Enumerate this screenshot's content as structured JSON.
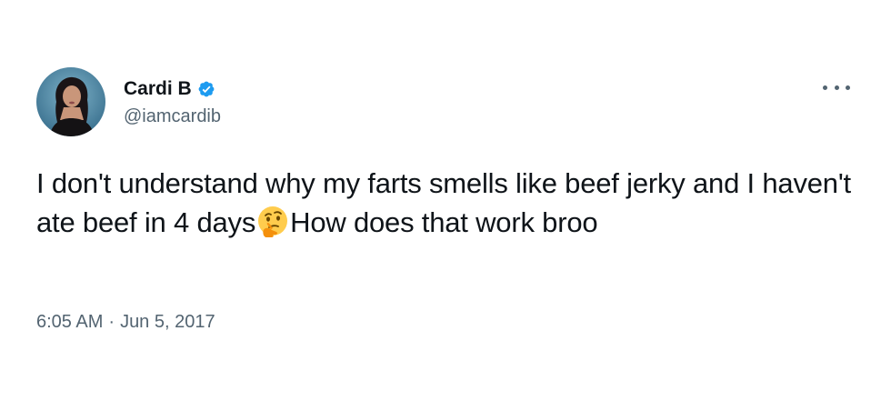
{
  "user": {
    "display_name": "Cardi B",
    "handle": "@iamcardib",
    "verified": true,
    "avatar_icon": "profile-photo"
  },
  "tweet": {
    "text_part1": "I don't understand why my farts smells like beef jerky and I haven't ate beef in 4 days",
    "emoji": "🤔",
    "emoji_icon": "thinking-face-emoji",
    "text_part2": "How does that work broo",
    "time": "6:05 AM",
    "separator": "·",
    "date": "Jun 5, 2017"
  },
  "menu": {
    "icon": "more-options-icon"
  },
  "colors": {
    "primary_text": "#0f1419",
    "secondary_text": "#536471",
    "verified_blue": "#1d9bf0",
    "background": "#ffffff"
  }
}
